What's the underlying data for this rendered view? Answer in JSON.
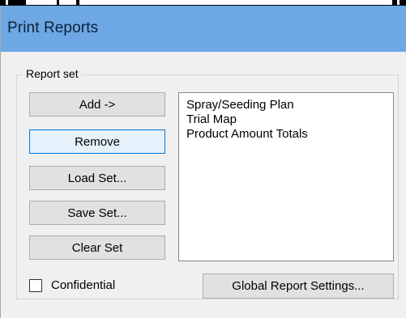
{
  "window": {
    "title": "Print Reports"
  },
  "report_set": {
    "legend": "Report set",
    "buttons": {
      "add": "Add ->",
      "remove": "Remove",
      "load": "Load Set...",
      "save": "Save Set...",
      "clear": "Clear Set"
    },
    "list_items": [
      "Spray/Seeding Plan",
      "Trial Map",
      "Product Amount Totals"
    ]
  },
  "confidential": {
    "label": "Confidential",
    "checked": false
  },
  "global_settings_button": "Global Report Settings..."
}
